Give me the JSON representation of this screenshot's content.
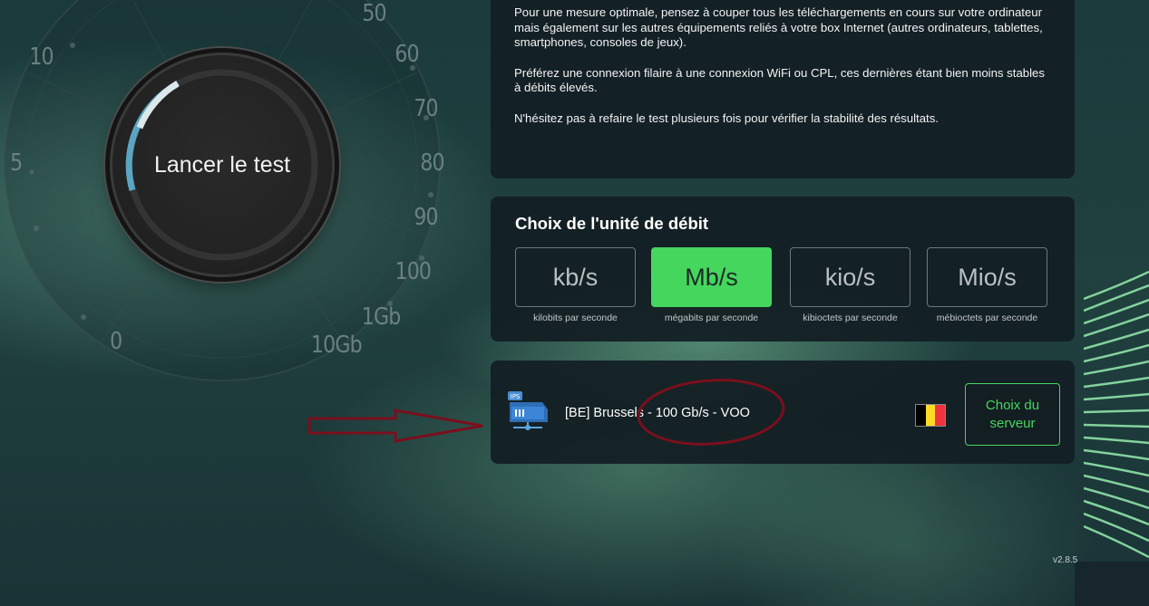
{
  "gauge": {
    "scale": [
      "5",
      "10",
      "50",
      "60",
      "70",
      "80",
      "90",
      "100",
      "1Gb",
      "10Gb",
      "0"
    ],
    "start_label": "Lancer le test"
  },
  "info": {
    "paragraphs": [
      "Pour une mesure optimale, pensez à couper tous les téléchargements en cours sur votre ordinateur mais également sur les autres équipements reliés à votre box Internet (autres ordinateurs, tablettes, smartphones, consoles de jeux).",
      "Préférez une connexion filaire à une connexion WiFi ou CPL, ces dernières étant bien moins stables à débits élevés.",
      "N'hésitez pas à refaire le test plusieurs fois pour vérifier la stabilité des résultats."
    ]
  },
  "units": {
    "title": "Choix de l'unité de débit",
    "options": [
      {
        "label": "kb/s",
        "sub": "kilobits par seconde",
        "selected": false
      },
      {
        "label": "Mb/s",
        "sub": "mégabits par seconde",
        "selected": true
      },
      {
        "label": "kio/s",
        "sub": "kibioctets par seconde",
        "selected": false
      },
      {
        "label": "Mio/s",
        "sub": "mébioctets par seconde",
        "selected": false
      }
    ],
    "accent_color": "#45d65e"
  },
  "server": {
    "icon": "ips-server-icon",
    "icon_label": "IPS",
    "name": "[BE] Brussels - 100 Gb/s - VOO",
    "flag": "belgium-flag",
    "flag_colors": [
      "#000000",
      "#fdda24",
      "#ef3340"
    ],
    "choose_label": "Choix du serveur"
  },
  "annotation_color": "#7a0f1c",
  "version": "v2.8.5"
}
